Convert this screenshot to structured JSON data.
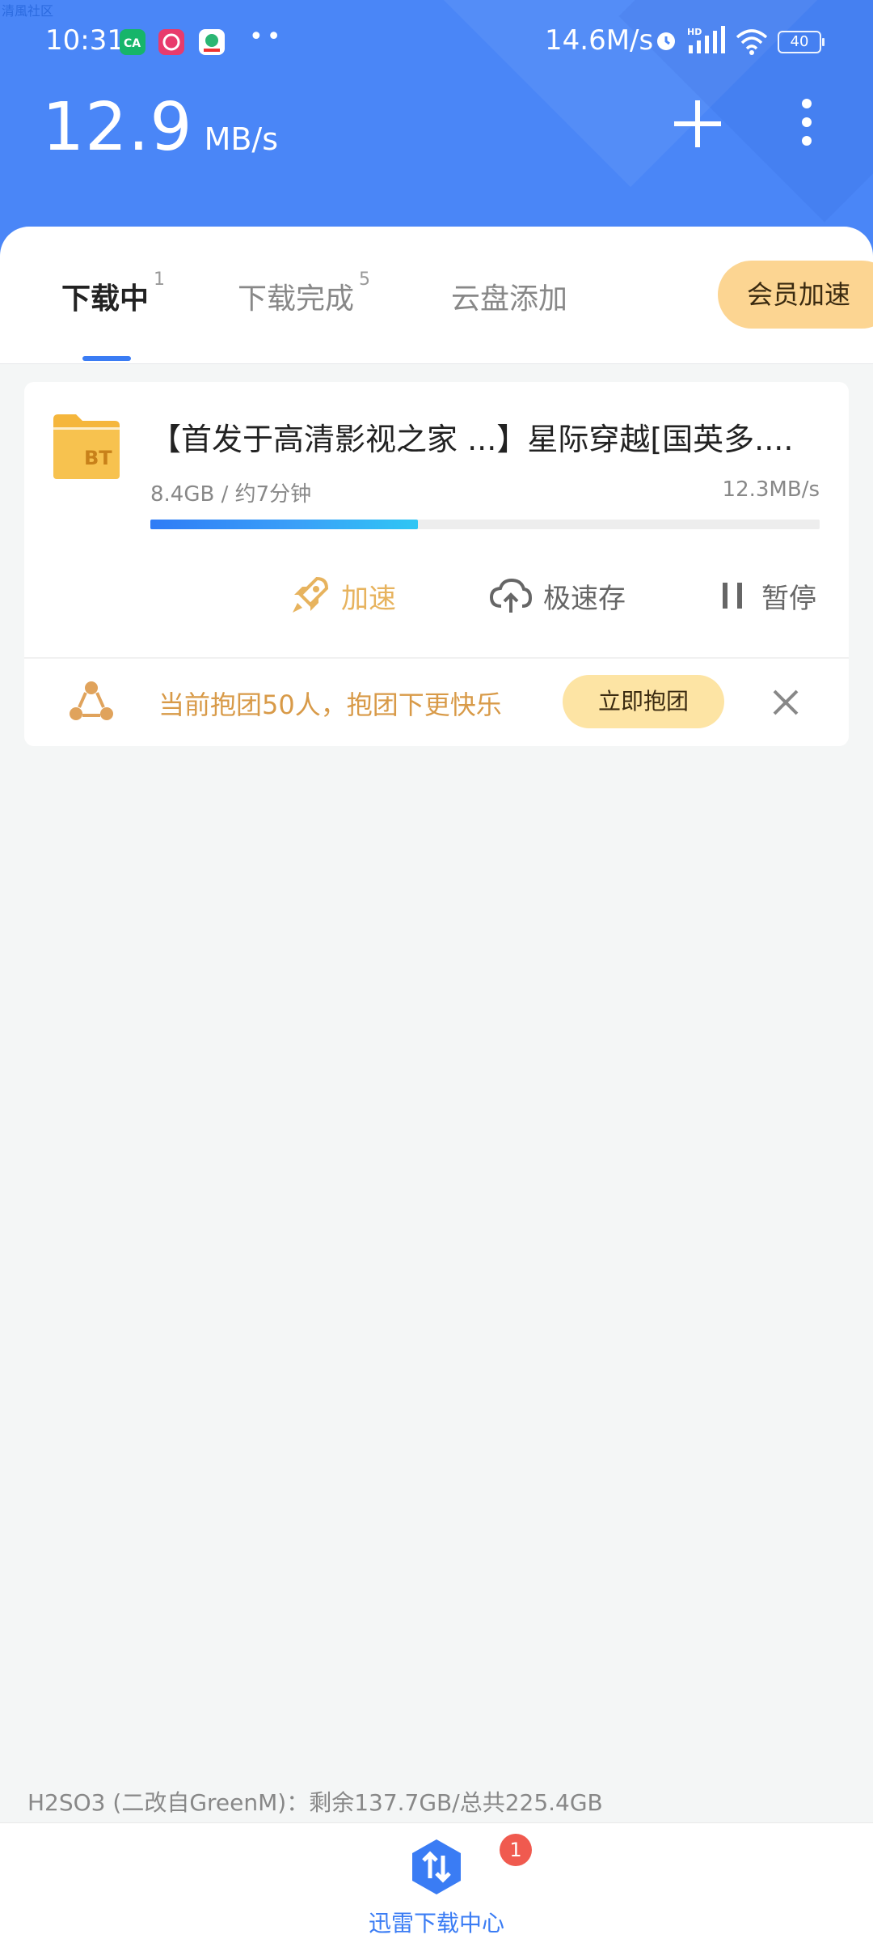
{
  "watermark": "清風社区",
  "status": {
    "time": "10:31",
    "network_speed": "14.6M/s",
    "battery": "40",
    "hd_label": "HD"
  },
  "header": {
    "speed_value": "12.9",
    "speed_unit": "MB/s"
  },
  "tabs": [
    {
      "label": "下载中",
      "count": "1"
    },
    {
      "label": "下载完成",
      "count": "5"
    },
    {
      "label": "云盘添加",
      "count": ""
    }
  ],
  "vip_button": "会员加速",
  "task": {
    "title": "【首发于高清影视之家 ...】星际穿越[国英多....",
    "size_eta": "8.4GB / 约7分钟",
    "speed": "12.3MB/s",
    "progress_percent": 40,
    "icon_label": "BT",
    "actions": {
      "boost": "加速",
      "save": "极速存",
      "pause": "暂停"
    }
  },
  "group_promo": {
    "text": "当前抱团50人，抱团下更快乐",
    "button": "立即抱团"
  },
  "storage": "H2SO3 (二改自GreenM)：剩余137.7GB/总共225.4GB",
  "bottom_nav": {
    "label": "迅雷下载中心",
    "badge": "1"
  },
  "colors": {
    "header_bg": "#4a86f7",
    "accent": "#3a7cf4",
    "vip": "#fcd592",
    "boost": "#e7b35e",
    "badge": "#f05a4f"
  }
}
